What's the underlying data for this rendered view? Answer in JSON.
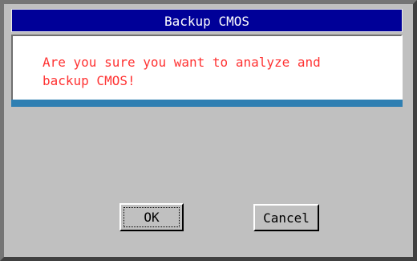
{
  "dialog": {
    "title": "Backup CMOS",
    "message": "Are you sure you want to analyze and\nbackup CMOS!",
    "buttons": {
      "ok_label": "OK",
      "cancel_label": "Cancel"
    }
  },
  "colors": {
    "title_bar": "#000098",
    "message_text": "#ff3333",
    "panel_accent": "#2f7fb2",
    "dialog_background": "#c0c0c0"
  }
}
